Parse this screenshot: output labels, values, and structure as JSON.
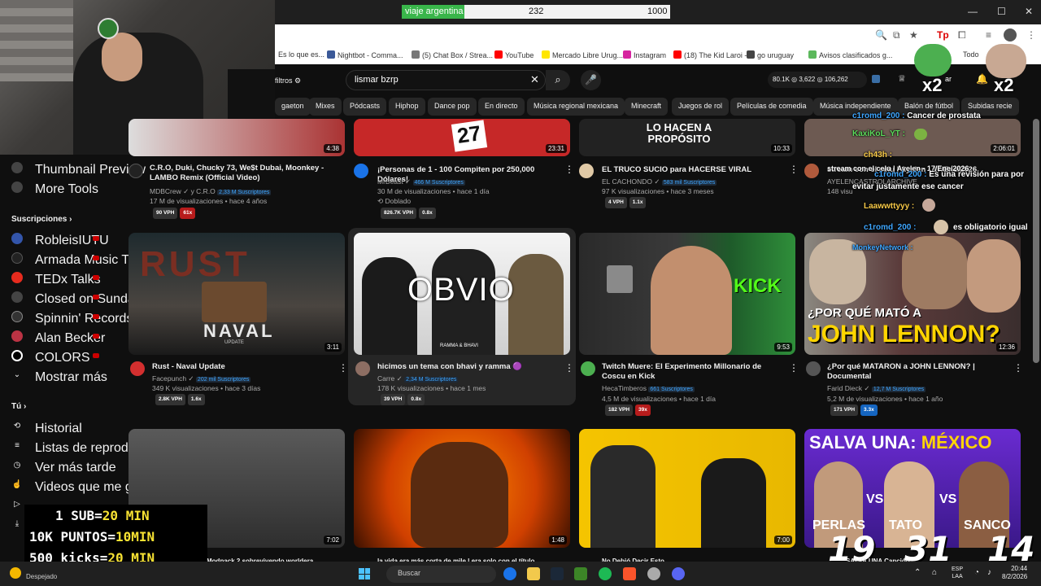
{
  "poll": {
    "label": "viaje argentina",
    "count": "232",
    "goal": "1000",
    "progress": 0.232
  },
  "window": {
    "min": "—",
    "max": "☐",
    "close": "✕"
  },
  "bookmarks": [
    {
      "label": "Es lo que es...",
      "color": "#888"
    },
    {
      "label": "Nightbot - Comma...",
      "color": "#3b5998"
    },
    {
      "label": "(5) Chat Box / Strea...",
      "color": "#777"
    },
    {
      "label": "YouTube",
      "color": "#ff0000"
    },
    {
      "label": "Mercado Libre Urug...",
      "color": "#ffe600"
    },
    {
      "label": "Instagram",
      "color": "#d6249f"
    },
    {
      "label": "(18) The Kid Laroi -...",
      "color": "#ff0000"
    },
    {
      "label": "go uruguay",
      "color": "#444"
    },
    {
      "label": "Avisos clasificados g...",
      "color": "#5cb85c"
    },
    {
      "label": "Todo",
      "color": "#aaa"
    }
  ],
  "header": {
    "filters_label": "filtros",
    "search_value": "lismar bzrp",
    "stat1": "80.1K",
    "stat2": "3,622",
    "stat3": "106,262",
    "emote_badge_left": "x2",
    "emote_badge_right": "x2",
    "obscured_btn": "ar"
  },
  "chips": [
    "gaeton",
    "Mixes",
    "Pódcasts",
    "Hiphop",
    "Dance pop",
    "En directo",
    "Música regional mexicana",
    "Minecraft",
    "Juegos de rol",
    "Películas de comedia",
    "Música independiente",
    "Balón de fútbol",
    "Subidas recie"
  ],
  "sidebar": {
    "top_items": [
      {
        "label": "Thumbnail Preview",
        "icon": "gear-icon"
      },
      {
        "label": "More Tools",
        "icon": "gear-icon"
      }
    ],
    "subs_heading": "Suscripciones",
    "subs": [
      {
        "label": "RobleisIUTU",
        "color": "#3355aa",
        "live": true
      },
      {
        "label": "Armada Music TV",
        "color": "#222",
        "live": true
      },
      {
        "label": "TEDx Talks",
        "color": "#e62b1e",
        "live": true
      },
      {
        "label": "Closed on Sunday",
        "color": "#444",
        "live": true
      },
      {
        "label": "Spinnin' Records",
        "color": "#333",
        "live": true
      },
      {
        "label": "Alan Becker",
        "color": "#b34",
        "live": true
      },
      {
        "label": "COLORS",
        "color": "#000",
        "live": true
      }
    ],
    "show_more": "Mostrar más",
    "you_heading": "Tú",
    "you_items": [
      {
        "label": "Historial",
        "icon": "history-icon",
        "glyph": "⟲"
      },
      {
        "label": "Listas de reproducc...",
        "icon": "playlist-icon",
        "glyph": "≡"
      },
      {
        "label": "Ver más tarde",
        "icon": "clock-icon",
        "glyph": "◷"
      },
      {
        "label": "Videos que me gus...",
        "icon": "thumbs-up-icon",
        "glyph": "👍"
      },
      {
        "label": "",
        "icon": "video-icon",
        "glyph": "▷"
      },
      {
        "label": "",
        "icon": "download-icon",
        "glyph": "⤓"
      }
    ]
  },
  "row1": [
    {
      "title": "C.R.O, Duki, Chucky 73, We$t Dubai, Moonkey - LAMBO Remix (Official Video)",
      "channel": "MDBCrew ✓ y C.R.O",
      "subs": "2,33 M Suscriptores",
      "meta": "17 M de visualizaciones • hace 4 años",
      "duration": "4:38",
      "badges": [
        "90 VPH",
        "61x"
      ],
      "extra": ""
    },
    {
      "title": "¡Personas de 1 - 100 Compiten por 250,000 Dólares!",
      "channel": "MrBeast",
      "subs": "466 M Suscriptores",
      "meta": "30 M de visualizaciones • hace 1 día",
      "duration": "23:31",
      "badges": [
        "826.7K VPH",
        "0.8x"
      ],
      "extra": "Doblado"
    },
    {
      "title": "EL TRUCO SUCIO para HACERSE VIRAL",
      "channel": "EL CACHONDO",
      "subs": "583 mil Suscriptores",
      "meta": "97 K visualizaciones • hace 3 meses",
      "duration": "10:33",
      "badges": [
        "4 VPH",
        "1.1x"
      ],
      "extra": ""
    },
    {
      "title": "stream con el celu | Ayelen - 17/Ene/2026",
      "channel": "AYELENCASTROLARCHIVE",
      "subs": "",
      "meta": "148 visu",
      "duration": "2:06:01",
      "badges": [],
      "extra": ""
    }
  ],
  "row1_thumb_texts": {
    "mrbeast_number": "27",
    "cachondo_text": "LO HACEN A PROPÓSITO"
  },
  "row2": [
    {
      "title": "Rust - Naval Update",
      "channel": "Facepunch",
      "subs": "202 mil Suscriptores",
      "meta": "349 K visualizaciones • hace 3 días",
      "duration": "3:11",
      "badges": [
        "2.8K VPH",
        "1.6x"
      ],
      "thumb_text": "NAVAL",
      "thumb_sub": "UPDATE",
      "thumb_bg_text": "RUST"
    },
    {
      "title": "hicimos un tema con bhavi y ramma 🟣",
      "channel": "Carre",
      "subs": "2,34 M Suscriptores",
      "meta": "178 K visualizaciones • hace 1 mes",
      "duration": "",
      "badges": [
        "39 VPH",
        "0.8x"
      ],
      "thumb_text": "OBVIO",
      "thumb_sub": "RAMMA & BHAVI"
    },
    {
      "title": "Twitch Muere: El Experimento Millonario de Coscu en Kick",
      "channel": "HecaTimberos",
      "subs": "661 Suscriptores",
      "meta": "HecaTimberos",
      "meta2": "4,5 M de visualizaciones • hace 1 día",
      "duration": "9:53",
      "badges": [
        "182 VPH",
        "39x"
      ],
      "thumb_text": "KICK"
    },
    {
      "title": "¿Por qué MATARON a JOHN LENNON? | Documental",
      "channel": "Farid Dieck",
      "subs": "12,7 M Suscriptores",
      "meta": "5,2 M de visualizaciones • hace 1 año",
      "duration": "12:36",
      "badges": [
        "171 VPH",
        "3.3x"
      ],
      "thumb_text1": "¿POR QUÉ MATÓ A",
      "thumb_text2": "JOHN LENNON?"
    }
  ],
  "row3": [
    {
      "duration": "7:02"
    },
    {
      "duration": "1:48"
    },
    {
      "duration": "7:00"
    },
    {
      "thumb_title": "SALVA UNA:",
      "thumb_country": "MÉXICO",
      "name1": "PERLAS",
      "name2": "TATO",
      "name3": "SANCO",
      "n1": "19",
      "n2": "31",
      "n3": "14",
      "vs": "VS"
    }
  ],
  "row3_partial_titles": [
    "Modpack 2 sobrevivendo worldera",
    "la vida era más corta de mile | era solo con el título",
    "No Debió Decir Esto",
    "SALVA UNA Canción M..."
  ],
  "chat": [
    {
      "user": "c1romd_200 :",
      "msg": "Cancer de prostata",
      "color": "#3ea6ff"
    },
    {
      "user": "KaxiKoL_YT :",
      "msg": "",
      "color": "#5cdb5c"
    },
    {
      "user": "ch43h :",
      "msg": "",
      "color": "#f7c948"
    },
    {
      "user": "stream con el celu | Ayelen - 17/Ene/2026",
      "msg": "",
      "color": "#fff"
    },
    {
      "user": "c1romd_200 :",
      "msg": "Es una revisión para por",
      "color": "#3ea6ff"
    },
    {
      "user": "evitar justamente ese cancer",
      "msg": "",
      "color": "#fff"
    },
    {
      "user": "Laawwttyyy :",
      "msg": "",
      "color": "#f7c948"
    },
    {
      "user": "c1romd_200 :",
      "msg": "",
      "color": "#3ea6ff"
    },
    {
      "user": "es obligatorio igual",
      "msg": "",
      "color": "#fff"
    },
    {
      "user": "MonkeyNetwork :",
      "msg": "",
      "color": "#3ea6ff"
    }
  ],
  "promo": {
    "line1": "1 SUB=",
    "val1": "20 MIN",
    "line2": "10K PUNTOS=",
    "val2": "10MIN",
    "line3": "500 kicks=",
    "val3": "20 MIN"
  },
  "taskbar": {
    "weather": "Despejado",
    "search": "Buscar",
    "lang1": "ESP",
    "lang2": "LAA",
    "time": "20:44",
    "date": "8/2/2026"
  }
}
